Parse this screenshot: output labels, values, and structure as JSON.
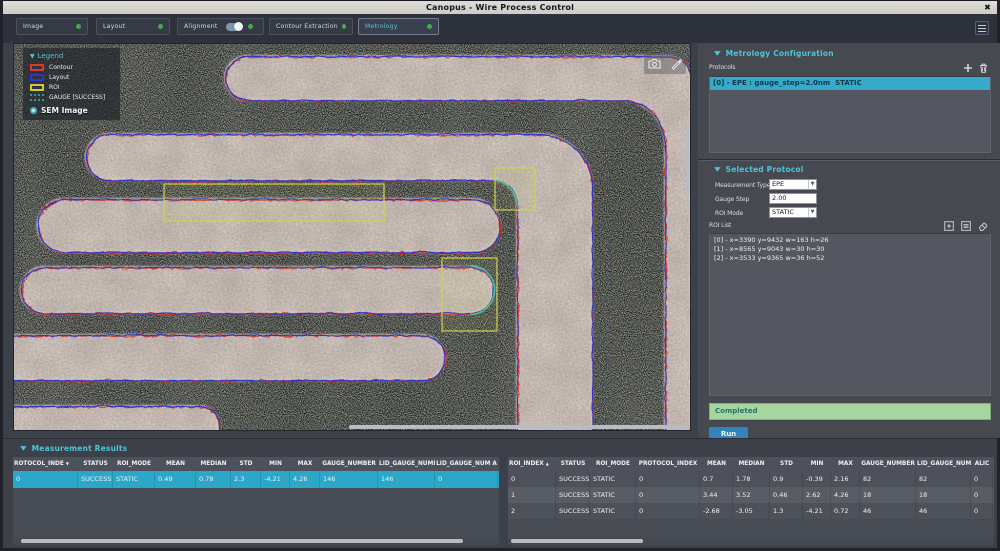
{
  "window": {
    "title": "Canopus - Wire Process Control",
    "close_label": "✖"
  },
  "tabs": [
    {
      "label": "Image"
    },
    {
      "label": "Layout"
    },
    {
      "label": "Alignment",
      "has_toggle": true,
      "toggle_on": true
    },
    {
      "label": "Contour Extraction"
    },
    {
      "label": "Metrology",
      "active": true
    }
  ],
  "image_view": {
    "legend": {
      "title": "Legend",
      "items": [
        {
          "label": "Contour",
          "color": "#d93a2e"
        },
        {
          "label": "Layout",
          "color": "#2d38c9"
        },
        {
          "label": "ROI",
          "color": "#cfc93e"
        },
        {
          "label": "GAUGE [SUCCESS]",
          "color": "#2f9a8c"
        }
      ],
      "footer": "SEM Image"
    },
    "rois": [
      "roi-rect-0",
      "roi-rect-1",
      "roi-rect-2"
    ]
  },
  "metrology_config": {
    "header": "Metrology Configuration",
    "protocols_label": "Protocols",
    "protocols": [
      "[0] - EPE : gauge_step=2.0nm  STATIC"
    ],
    "selected_protocol": {
      "header": "Selected Protocol",
      "fields": [
        {
          "label": "Measurement Type",
          "value": "EPE",
          "type": "select"
        },
        {
          "label": "Gauge Step",
          "value": "2.00",
          "type": "input"
        },
        {
          "label": "ROI Mode",
          "value": "STATIC",
          "type": "select"
        }
      ],
      "roi_list_label": "ROI List",
      "roi_list": [
        "[0] - x=3390 y=9432 w=163 h=26",
        "[1] - x=8565 y=9043 w=30 h=30",
        "[2] - x=3533 y=9365 w=36 h=52"
      ]
    },
    "status": "Completed",
    "run_label": "Run"
  },
  "results": {
    "header": "Measurement Results",
    "left_table": {
      "headers": [
        "ROTOCOL_INDE",
        "STATUS",
        "ROI_MODE",
        "MEAN",
        "MEDIAN",
        "STD",
        "MIN",
        "MAX",
        "GAUGE_NUMBER",
        "LID_GAUGE_NUMI",
        "LID_GAUGE_NUM A"
      ],
      "sort": {
        "column": 0,
        "dir": "desc"
      },
      "selected_row": 0,
      "rows": [
        [
          "0",
          "SUCCESS",
          "STATIC",
          "0.49",
          "0.78",
          "2.3",
          "-4.21",
          "4.26",
          "146",
          "146",
          "0"
        ]
      ]
    },
    "right_table": {
      "headers": [
        "ROI_INDEX",
        "STATUS",
        "ROI_MODE",
        "PROTOCOL_INDEX",
        "MEAN",
        "MEDIAN",
        "STD",
        "MIN",
        "MAX",
        "GAUGE_NUMBER",
        "LID_GAUGE_NUMB",
        "ALIC"
      ],
      "sort": {
        "column": 0,
        "dir": "asc"
      },
      "rows": [
        [
          "0",
          "SUCCESS",
          "STATIC",
          "0",
          "0.7",
          "1.78",
          "0.9",
          "-0.39",
          "2.16",
          "82",
          "82",
          "0"
        ],
        [
          "1",
          "SUCCESS",
          "STATIC",
          "0",
          "3.44",
          "3.52",
          "0.46",
          "2.62",
          "4.26",
          "18",
          "18",
          "0"
        ],
        [
          "2",
          "SUCCESS",
          "STATIC",
          "0",
          "-2.68",
          "-3.05",
          "1.3",
          "-4.21",
          "0.72",
          "46",
          "46",
          "0"
        ]
      ]
    }
  },
  "colors": {
    "accent_teal": "#4fc3d8",
    "selection_teal": "#35aac9",
    "success_green_dot": "#3fae46",
    "status_completed_bg": "#a7d5a0",
    "run_button_blue": "#3285ba",
    "contour_red": "#d93a2e",
    "layout_blue": "#2d38c9",
    "roi_yellow": "#cfc93e",
    "gauge_teal": "#35b8a0"
  }
}
